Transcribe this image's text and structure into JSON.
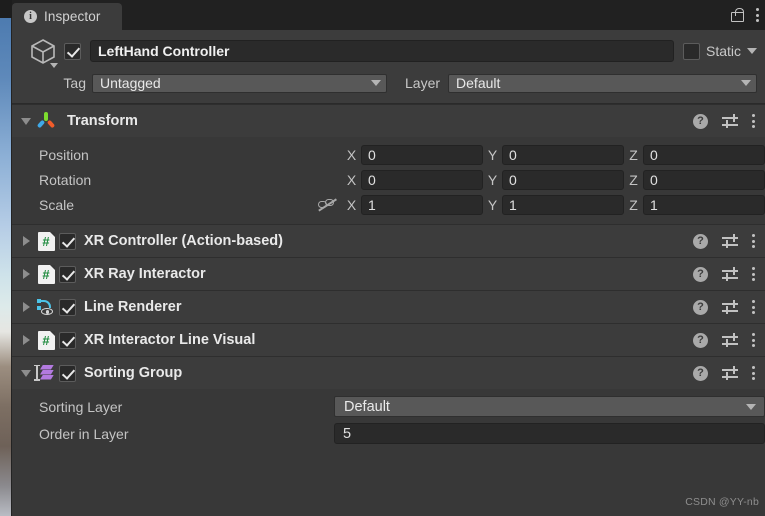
{
  "window": {
    "tab_label": "Inspector",
    "tab_icon": "info-icon",
    "lock_icon": "lock-icon",
    "menu_icon": "kebab-menu-icon"
  },
  "gameobject": {
    "icon": "cube-icon",
    "enabled": true,
    "name": "LeftHand Controller",
    "static_label": "Static",
    "static_checked": false,
    "tag_label": "Tag",
    "tag_value": "Untagged",
    "layer_label": "Layer",
    "layer_value": "Default"
  },
  "transform": {
    "title": "Transform",
    "icon": "transform-gizmo-icon",
    "expanded": true,
    "rows": [
      {
        "label": "Position",
        "x": "0",
        "y": "0",
        "z": "0",
        "link": false
      },
      {
        "label": "Rotation",
        "x": "0",
        "y": "0",
        "z": "0",
        "link": false
      },
      {
        "label": "Scale",
        "x": "1",
        "y": "1",
        "z": "1",
        "link": true
      }
    ],
    "axis_x": "X",
    "axis_y": "Y",
    "axis_z": "Z",
    "help_icon": "help-icon",
    "preset_icon": "preset-icon",
    "menu_icon": "kebab-menu-icon"
  },
  "components": [
    {
      "title": "XR Controller (Action-based)",
      "icon": "csharp-script-icon",
      "enabled": true,
      "expanded": false
    },
    {
      "title": "XR Ray Interactor",
      "icon": "csharp-script-icon",
      "enabled": true,
      "expanded": false
    },
    {
      "title": "Line Renderer",
      "icon": "line-renderer-icon",
      "enabled": true,
      "expanded": false
    },
    {
      "title": "XR Interactor Line Visual",
      "icon": "csharp-script-icon",
      "enabled": true,
      "expanded": false
    }
  ],
  "sorting_group": {
    "title": "Sorting Group",
    "icon": "sorting-group-icon",
    "enabled": true,
    "expanded": true,
    "sorting_layer_label": "Sorting Layer",
    "sorting_layer_value": "Default",
    "order_in_layer_label": "Order in Layer",
    "order_in_layer_value": "5"
  },
  "watermark": "CSDN @YY-nb",
  "colors": {
    "panel_bg": "#383838",
    "header_bg": "#3c3c3c",
    "tabbar_bg": "#212121",
    "field_bg": "#2a2a2a",
    "dropdown_bg": "#585858",
    "text": "#e9e9e9",
    "script_green": "#1d8a3d",
    "sorting_purple": "#b37ae0",
    "line_blue": "#4cc3e8"
  }
}
